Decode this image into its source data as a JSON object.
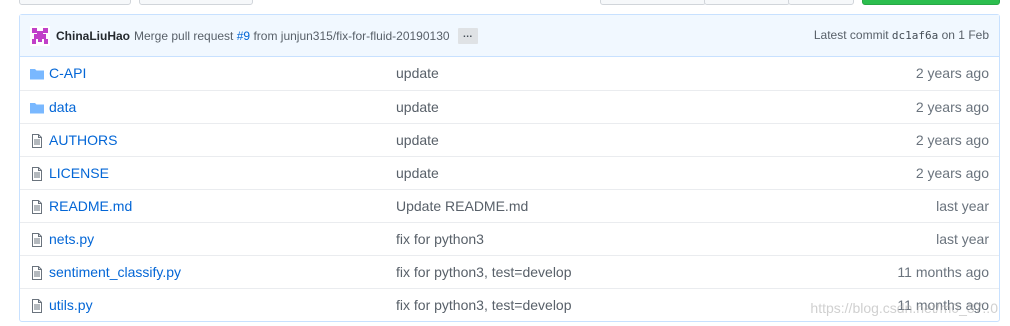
{
  "commit": {
    "author": "ChinaLiuHao",
    "message_prefix": "Merge pull request",
    "pr_link": "#9",
    "message_suffix": "from junjun315/fix-for-fluid-20190130",
    "ellipsis": "…",
    "latest_label": "Latest commit",
    "sha": "dc1af6a",
    "date": "on 1 Feb"
  },
  "files": [
    {
      "type": "directory",
      "icon": "folder-icon",
      "name": "C-API",
      "message": "update",
      "age": "2 years ago"
    },
    {
      "type": "directory",
      "icon": "folder-icon",
      "name": "data",
      "message": "update",
      "age": "2 years ago"
    },
    {
      "type": "file",
      "icon": "file-icon",
      "name": "AUTHORS",
      "message": "update",
      "age": "2 years ago"
    },
    {
      "type": "file",
      "icon": "file-icon",
      "name": "LICENSE",
      "message": "update",
      "age": "2 years ago"
    },
    {
      "type": "file",
      "icon": "file-icon",
      "name": "README.md",
      "message": "Update README.md",
      "age": "last year"
    },
    {
      "type": "file",
      "icon": "file-icon",
      "name": "nets.py",
      "message": "fix for python3",
      "age": "last year"
    },
    {
      "type": "file",
      "icon": "file-icon",
      "name": "sentiment_classify.py",
      "message": "fix for python3, test=develop",
      "age": "11 months ago"
    },
    {
      "type": "file",
      "icon": "file-icon",
      "name": "utils.py",
      "message": "fix for python3, test=develop",
      "age": "11 months ago"
    }
  ],
  "watermark": "https://blog.csdn.net/m0_37..0",
  "colors": {
    "link": "#0366d6",
    "folder": "#79b8ff",
    "commit_bar_bg": "#f1f8ff",
    "border": "#c8e1ff",
    "green_button": "#2cbe4e"
  }
}
